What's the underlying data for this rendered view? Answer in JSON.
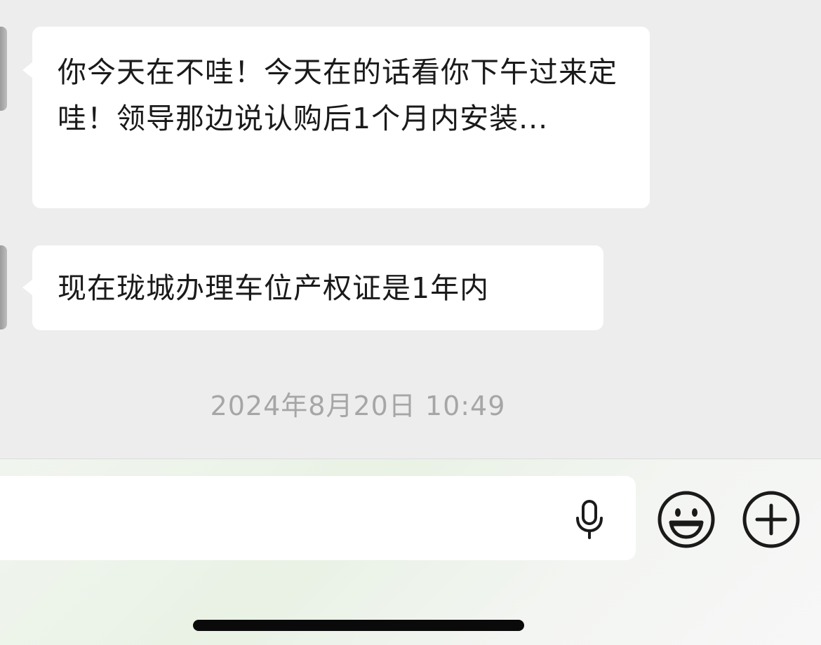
{
  "messages": [
    {
      "sender": "other",
      "text": "你今天在不哇！今天在的话看你下午过来定哇！领导那边说认购后1个月内安装..."
    },
    {
      "sender": "other",
      "text": "现在珑城办理车位产权证是1年内"
    }
  ],
  "timestamp": "2024年8月20日 10:49",
  "input": {
    "value": "",
    "placeholder": ""
  },
  "icons": {
    "voice": "microphone-icon",
    "emoji": "smiley-face-icon",
    "more": "plus-circle-icon"
  },
  "colors": {
    "chat_background": "#ededed",
    "bubble": "#ffffff",
    "timestamp_text": "#a6a6a6",
    "icon_stroke": "#1a1a1a"
  }
}
